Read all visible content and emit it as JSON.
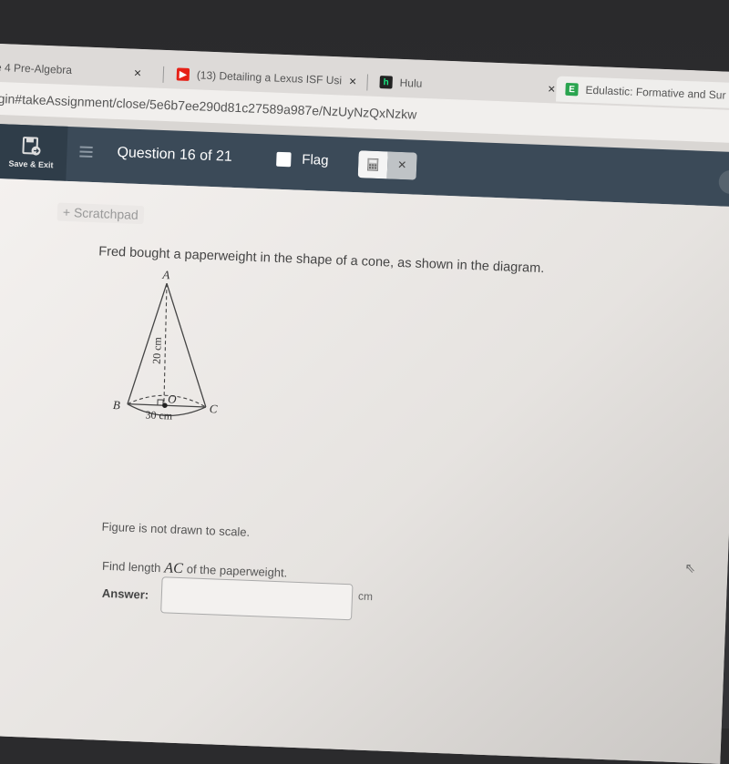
{
  "browser": {
    "tabs": [
      {
        "label": "e 4 Pre-Algebra",
        "favicon": "none",
        "close": "×"
      },
      {
        "label": "(13) Detailing a Lexus ISF Usi",
        "favicon": "youtube-icon",
        "favicon_color": "#e62117",
        "close": "×"
      },
      {
        "label": "Hulu",
        "favicon": "hulu-icon",
        "favicon_text": "h",
        "favicon_color": "#1ce783",
        "close": "×"
      },
      {
        "label": "Edulastic: Formative and Sur",
        "favicon": "edulastic-icon",
        "favicon_text": "E",
        "favicon_color": "#2aa44f",
        "close": "×",
        "active": true
      }
    ],
    "url": "gin#takeAssignment/close/5e6b7ee290d81c27589a987e/NzUyNzQxNzkw"
  },
  "header": {
    "save_exit_label": "Save & Exit",
    "question_label": "Question 16 of 21",
    "flag_label": "Flag",
    "flag_checked": false,
    "calculator_icon": "calculator-icon",
    "close_icon": "×",
    "side_toggle_icon": "‹",
    "colors": {
      "bar": "#3b4a58",
      "save_bg": "#2f3d49"
    }
  },
  "content": {
    "scratchpad_label": "+ Scratchpad",
    "question_text": "Fred bought a paperweight in the shape of a cone, as shown in the diagram.",
    "diagram": {
      "apex_label": "A",
      "left_label": "B",
      "right_label": "C",
      "center_label": "O",
      "height_label": "20 cm",
      "diameter_label": "30 cm"
    },
    "note": "Figure is not drawn to scale.",
    "prompt_before": "Find length",
    "prompt_var": "AC",
    "prompt_after": "of the paperweight.",
    "answer_label": "Answer:",
    "answer_value": "",
    "answer_unit": "cm"
  }
}
